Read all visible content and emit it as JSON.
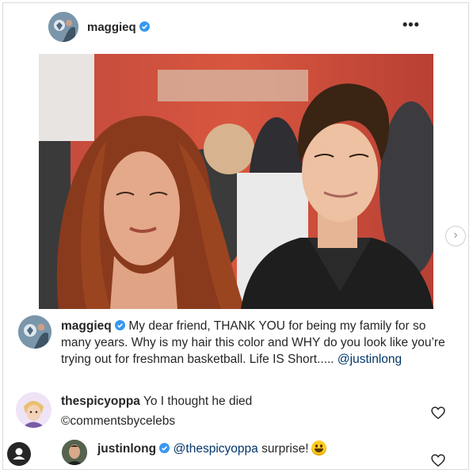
{
  "post": {
    "username": "maggieq",
    "more_glyph": "•••",
    "next_glyph": "›"
  },
  "caption": {
    "username": "maggieq",
    "text": "My dear friend, THANK YOU for being my family for so many years. Why is my hair this color and WHY do you look like you’re trying out for freshman basketball. Life IS Short..... ",
    "mention": "@justinlong"
  },
  "comments": [
    {
      "username": "thespicyoppa",
      "text": "Yo I thought he died",
      "credit": "©commentsbycelebs"
    }
  ],
  "reply": {
    "username": "justinlong",
    "mention": "@thespicyoppa",
    "text": "surprise!"
  },
  "icons": {
    "verified": "verified-badge-icon",
    "heart": "heart-outline-icon",
    "user": "user-profile-icon",
    "emoji": "grinning-face-emoji",
    "more": "more-options-icon",
    "next": "chevron-right-icon"
  },
  "colors": {
    "verified_blue": "#3897f0",
    "text": "#262626",
    "mention": "#003569",
    "border": "#dbdbdb"
  }
}
